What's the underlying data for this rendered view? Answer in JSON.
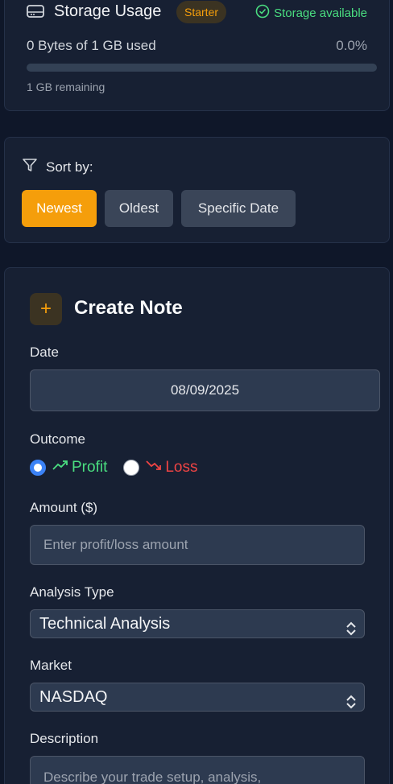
{
  "storage": {
    "title": "Storage Usage",
    "plan_badge": "Starter",
    "status": "Storage available",
    "used_text": "0 Bytes of 1 GB used",
    "percent_text": "0.0%",
    "used_fraction": 0.0,
    "remaining_text": "1 GB remaining"
  },
  "sort": {
    "label": "Sort by:",
    "options": [
      "Newest",
      "Oldest",
      "Specific Date"
    ],
    "active": "Newest"
  },
  "create_note": {
    "title": "Create Note",
    "plus_symbol": "+",
    "date_label": "Date",
    "date_value": "08/09/2025",
    "outcome_label": "Outcome",
    "outcome_options": [
      "Profit",
      "Loss"
    ],
    "outcome_selected": "Profit",
    "amount_label": "Amount ($)",
    "amount_placeholder": "Enter profit/loss amount",
    "analysis_label": "Analysis Type",
    "analysis_value": "Technical Analysis",
    "market_label": "Market",
    "market_value": "NASDAQ",
    "description_label": "Description",
    "description_placeholder": "Describe your trade setup, analysis,"
  },
  "colors": {
    "accent": "#f59e0b",
    "profit": "#4ade80",
    "loss": "#ef4444",
    "radio_selected": "#3b82f6",
    "background": "#0f1729"
  },
  "icons": [
    "hard-drive-icon",
    "check-circle-icon",
    "filter-icon",
    "trending-up-icon",
    "trending-down-icon",
    "chevron-updown-icon"
  ]
}
